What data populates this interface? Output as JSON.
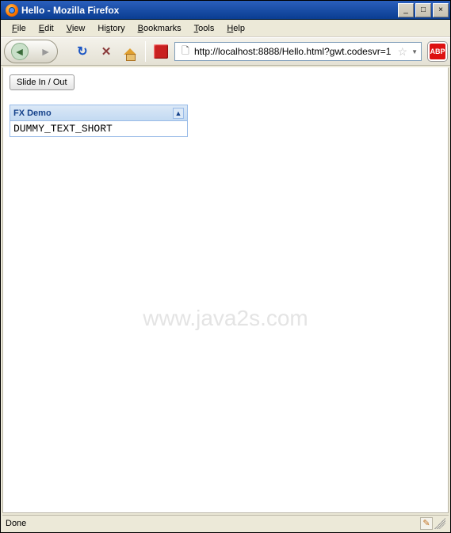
{
  "window": {
    "title": "Hello - Mozilla Firefox",
    "min_label": "_",
    "max_label": "□",
    "close_label": "×"
  },
  "menu": {
    "file": "File",
    "edit": "Edit",
    "view": "View",
    "history": "History",
    "bookmarks": "Bookmarks",
    "tools": "Tools",
    "help": "Help"
  },
  "toolbar": {
    "url": "http://localhost:8888/Hello.html?gwt.codesvr=1",
    "abp_label": "ABP"
  },
  "page": {
    "slide_button": "Slide In / Out",
    "panel_title": "FX Demo",
    "panel_body": "DUMMY_TEXT_SHORT"
  },
  "watermark": "www.java2s.com",
  "status": {
    "text": "Done"
  }
}
